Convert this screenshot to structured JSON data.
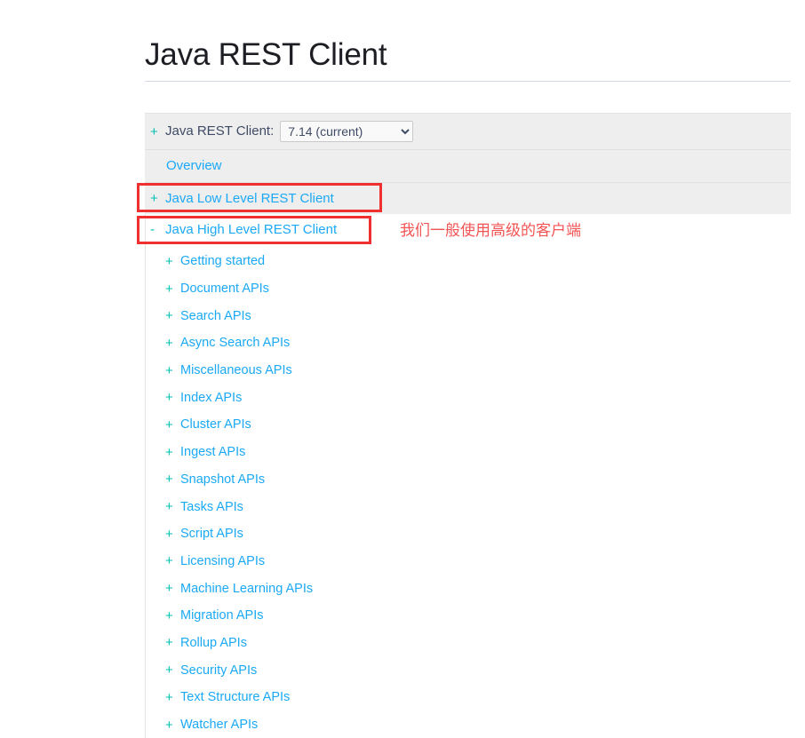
{
  "page": {
    "title": "Java REST Client"
  },
  "toc": {
    "version_row": {
      "expander": "+",
      "label": "Java REST Client:",
      "select_value": "7.14 (current)",
      "select_options": [
        "7.14 (current)"
      ]
    },
    "rows": [
      {
        "expander": "",
        "label": "Overview",
        "type": "link"
      },
      {
        "expander": "+",
        "label": "Java Low Level REST Client",
        "type": "link"
      },
      {
        "expander": "-",
        "label": "Java High Level REST Client",
        "type": "link"
      }
    ],
    "sub_items": [
      {
        "expander": "+",
        "label": "Getting started"
      },
      {
        "expander": "+",
        "label": "Document APIs"
      },
      {
        "expander": "+",
        "label": "Search APIs"
      },
      {
        "expander": "+",
        "label": "Async Search APIs"
      },
      {
        "expander": "+",
        "label": "Miscellaneous APIs"
      },
      {
        "expander": "+",
        "label": "Index APIs"
      },
      {
        "expander": "+",
        "label": "Cluster APIs"
      },
      {
        "expander": "+",
        "label": "Ingest APIs"
      },
      {
        "expander": "+",
        "label": "Snapshot APIs"
      },
      {
        "expander": "+",
        "label": "Tasks APIs"
      },
      {
        "expander": "+",
        "label": "Script APIs"
      },
      {
        "expander": "+",
        "label": "Licensing APIs"
      },
      {
        "expander": "+",
        "label": "Machine Learning APIs"
      },
      {
        "expander": "+",
        "label": "Migration APIs"
      },
      {
        "expander": "+",
        "label": "Rollup APIs"
      },
      {
        "expander": "+",
        "label": "Security APIs"
      },
      {
        "expander": "+",
        "label": "Text Structure APIs"
      },
      {
        "expander": "+",
        "label": "Watcher APIs"
      }
    ]
  },
  "annotations": {
    "note_text": "我们一般使用高级的客户端",
    "note_color": "#f25454",
    "box_color": "#f03030"
  },
  "colors": {
    "link": "#1ba9f5",
    "expander": "#00bfb3",
    "header_label": "#3f4b65",
    "table_bg": "#eeeeee",
    "title": "#1c1e23"
  }
}
